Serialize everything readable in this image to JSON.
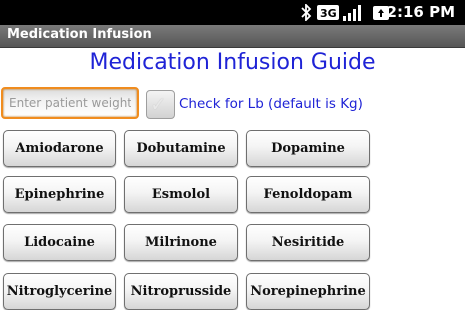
{
  "status_bar": {
    "time": "2:16 PM",
    "icons": [
      "bluetooth-icon",
      "data-network-icon",
      "signal-bars-icon",
      "battery-icon"
    ],
    "background_color": "#000000"
  },
  "title_bar": {
    "title": "Medication Infusion"
  },
  "main": {
    "heading": "Medication Infusion Guide",
    "heading_color": "#1f23d6",
    "weight_input": {
      "placeholder": "Enter patient weight",
      "value": "",
      "focus_color": "#f08c1e"
    },
    "lb_checkbox": {
      "label": "Check for Lb (default is Kg)",
      "checked": false
    },
    "drug_buttons": [
      [
        "Amiodarone",
        "Dobutamine",
        "Dopamine"
      ],
      [
        "Epinephrine",
        "Esmolol",
        "Fenoldopam"
      ],
      [
        "Lidocaine",
        "Milrinone",
        "Nesiritide"
      ],
      [
        "Nitroglycerine",
        "Nitroprusside",
        "Norepinephrine"
      ]
    ]
  }
}
